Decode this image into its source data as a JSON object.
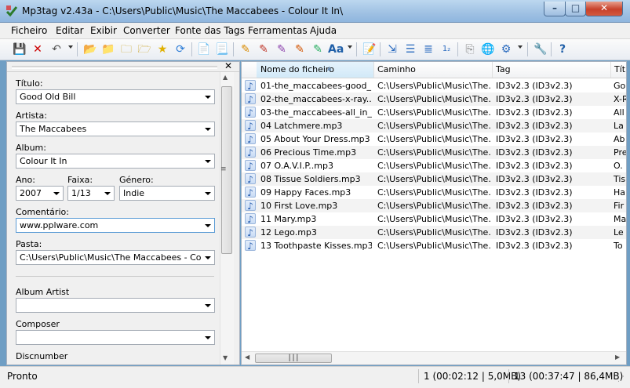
{
  "window": {
    "title": "Mp3tag v2.43a  -  C:\\Users\\Public\\Music\\The Maccabees - Colour It In\\"
  },
  "menu": [
    "Ficheiro",
    "Editar",
    "Exibir",
    "Converter",
    "Fonte das Tags",
    "Ferramentas",
    "Ajuda"
  ],
  "toolbar_icons": [
    "save-icon",
    "remove-icon",
    "undo-icon",
    "add-directory-icon",
    "open-folder-icon",
    "add-folder-icon",
    "folder-up-icon",
    "favorites-star-icon",
    "refresh-icon",
    "tag-filename-icon",
    "filename-tag-icon",
    "freedb-icon",
    "amazon-icon",
    "discogs-icon",
    "musicbrainz-icon",
    "case-conversion-icon",
    "text-edit-icon",
    "export-icon",
    "playlist-icon",
    "autonumber-icon",
    "copy-icon",
    "web-sources-icon",
    "actions-icon",
    "options-icon",
    "help-icon"
  ],
  "tag_panel": {
    "fields": {
      "title": {
        "label": "Título:",
        "value": "Good Old Bill"
      },
      "artist": {
        "label": "Artista:",
        "value": "The Maccabees"
      },
      "album": {
        "label": "Album:",
        "value": "Colour It In"
      },
      "year": {
        "label": "Ano:",
        "value": "2007"
      },
      "track": {
        "label": "Faixa:",
        "value": "1/13"
      },
      "genre": {
        "label": "Género:",
        "value": "Indie"
      },
      "comment": {
        "label": "Comentário:",
        "value": "www.pplware.com"
      },
      "folder": {
        "label": "Pasta:",
        "value": "C:\\Users\\Public\\Music\\The Maccabees - Colour I"
      },
      "album_artist": {
        "label": "Album Artist",
        "value": ""
      },
      "composer": {
        "label": "Composer",
        "value": ""
      },
      "discnumber": {
        "label": "Discnumber"
      }
    }
  },
  "file_list": {
    "columns": [
      "Nome do ficheiro",
      "Caminho",
      "Tag",
      "Tít"
    ],
    "rows": [
      {
        "name": "01-the_maccabees-good_...",
        "path": "C:\\Users\\Public\\Music\\The...",
        "tag": "ID3v2.3 (ID3v2.3)",
        "title": "Go"
      },
      {
        "name": "02-the_maccabees-x-ray....",
        "path": "C:\\Users\\Public\\Music\\The...",
        "tag": "ID3v2.3 (ID3v2.3)",
        "title": "X-R"
      },
      {
        "name": "03-the_maccabees-all_in_...",
        "path": "C:\\Users\\Public\\Music\\The...",
        "tag": "ID3v2.3 (ID3v2.3)",
        "title": "All"
      },
      {
        "name": "04 Latchmere.mp3",
        "path": "C:\\Users\\Public\\Music\\The...",
        "tag": "ID3v2.3 (ID3v2.3)",
        "title": "La"
      },
      {
        "name": "05 About Your Dress.mp3",
        "path": "C:\\Users\\Public\\Music\\The...",
        "tag": "ID3v2.3 (ID3v2.3)",
        "title": "Ab"
      },
      {
        "name": "06 Precious Time.mp3",
        "path": "C:\\Users\\Public\\Music\\The...",
        "tag": "ID3v2.3 (ID3v2.3)",
        "title": "Pre"
      },
      {
        "name": "07 O.A.V.I.P..mp3",
        "path": "C:\\Users\\Public\\Music\\The...",
        "tag": "ID3v2.3 (ID3v2.3)",
        "title": "O."
      },
      {
        "name": "08 Tissue Soldiers.mp3",
        "path": "C:\\Users\\Public\\Music\\The...",
        "tag": "ID3v2.3 (ID3v2.3)",
        "title": "Tis"
      },
      {
        "name": "09 Happy Faces.mp3",
        "path": "C:\\Users\\Public\\Music\\The...",
        "tag": "ID3v2.3 (ID3v2.3)",
        "title": "Ha"
      },
      {
        "name": "10 First Love.mp3",
        "path": "C:\\Users\\Public\\Music\\The...",
        "tag": "ID3v2.3 (ID3v2.3)",
        "title": "Fir"
      },
      {
        "name": "11 Mary.mp3",
        "path": "C:\\Users\\Public\\Music\\The...",
        "tag": "ID3v2.3 (ID3v2.3)",
        "title": "Ma"
      },
      {
        "name": "12 Lego.mp3",
        "path": "C:\\Users\\Public\\Music\\The...",
        "tag": "ID3v2.3 (ID3v2.3)",
        "title": "Le"
      },
      {
        "name": "13 Toothpaste Kisses.mp3",
        "path": "C:\\Users\\Public\\Music\\The...",
        "tag": "ID3v2.3 (ID3v2.3)",
        "title": "To"
      }
    ]
  },
  "status": {
    "text": "Pronto",
    "selected": "1 (00:02:12 | 5,0MB)",
    "total": "13 (00:37:47 | 86,4MB)"
  }
}
